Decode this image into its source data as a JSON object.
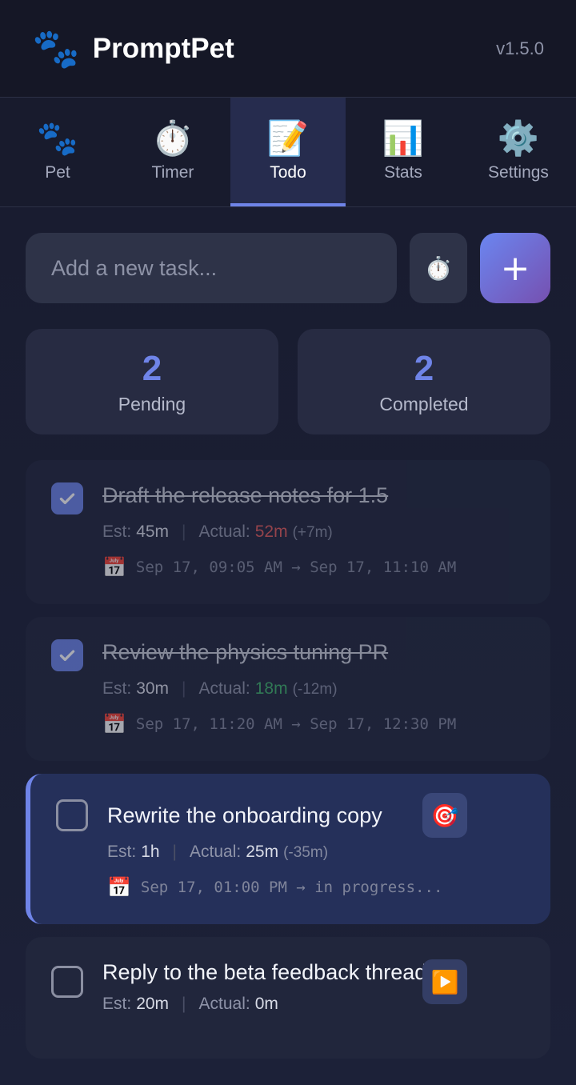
{
  "header": {
    "logo_icon": "🐾",
    "title": "PromptPet",
    "version": "v1.5.0"
  },
  "tabs": [
    {
      "icon": "🐾",
      "label": "Pet"
    },
    {
      "icon": "⏱️",
      "label": "Timer"
    },
    {
      "icon": "📝",
      "label": "Todo"
    },
    {
      "icon": "📊",
      "label": "Stats"
    },
    {
      "icon": "⚙️",
      "label": "Settings"
    }
  ],
  "active_tab": "Todo",
  "add_task": {
    "placeholder": "Add a new task...",
    "timer_icon": "⏱️",
    "add_label": "+"
  },
  "stats": {
    "pending": {
      "count": "2",
      "label": "Pending"
    },
    "completed": {
      "count": "2",
      "label": "Completed"
    }
  },
  "labels": {
    "est": "Est:",
    "actual": "Actual:",
    "sep": "|"
  },
  "tasks": [
    {
      "title": "Draft the release notes for 1.5",
      "done": true,
      "est": "45m",
      "actual": "52m",
      "diff": "(+7m)",
      "dates": "Sep 17, 09:05 AM → Sep 17, 11:10 AM",
      "calendar_icon": "📅"
    },
    {
      "title": "Review the physics tuning PR",
      "done": true,
      "est": "30m",
      "actual": "18m",
      "diff": "(-12m)",
      "dates": "Sep 17, 11:20 AM → Sep 17, 12:30 PM",
      "calendar_icon": "📅"
    },
    {
      "title": "Rewrite the onboarding copy",
      "done": false,
      "active": true,
      "est": "1h",
      "actual": "25m",
      "diff": "(-35m)",
      "dates": "Sep 17, 01:00 PM → in progress...",
      "calendar_icon": "📅",
      "action_icon": "🎯"
    },
    {
      "title": "Reply to the beta feedback thread",
      "done": false,
      "est": "20m",
      "actual": "0m",
      "action_icon": "▶️"
    }
  ]
}
